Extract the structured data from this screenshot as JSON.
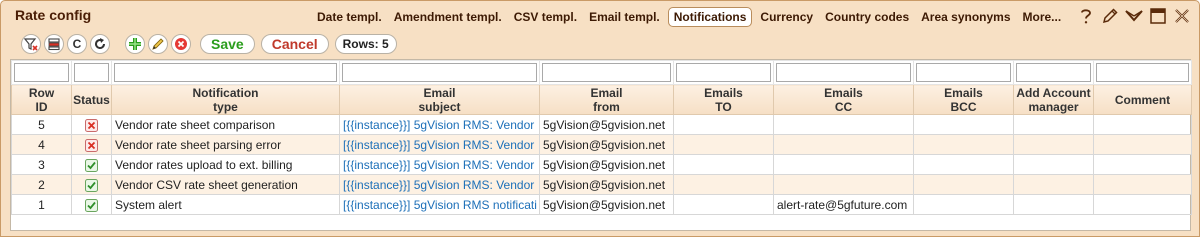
{
  "window": {
    "title": "Rate config"
  },
  "tabs": [
    {
      "label": "Date templ.",
      "active": false
    },
    {
      "label": "Amendment templ.",
      "active": false
    },
    {
      "label": "CSV templ.",
      "active": false
    },
    {
      "label": "Email templ.",
      "active": false
    },
    {
      "label": "Notifications",
      "active": true
    },
    {
      "label": "Currency",
      "active": false
    },
    {
      "label": "Country codes",
      "active": false
    },
    {
      "label": "Area synonyms",
      "active": false
    },
    {
      "label": "More...",
      "active": false
    }
  ],
  "window_icons": [
    "help-icon",
    "pencil-icon",
    "chevron-down-icon",
    "maximize-icon",
    "close-icon"
  ],
  "toolbar": {
    "buttons": [
      "clear-filter-icon",
      "columns-icon",
      "C",
      "reload-icon",
      "add-icon",
      "edit-icon",
      "delete-icon"
    ],
    "save_label": "Save",
    "cancel_label": "Cancel",
    "rows_label": "Rows: 5"
  },
  "grid": {
    "columns": [
      {
        "line1": "Row",
        "line2": "ID"
      },
      {
        "line1": "Status",
        "line2": ""
      },
      {
        "line1": "Notification",
        "line2": "type"
      },
      {
        "line1": "Email",
        "line2": "subject"
      },
      {
        "line1": "Email",
        "line2": "from"
      },
      {
        "line1": "Emails",
        "line2": "TO"
      },
      {
        "line1": "Emails",
        "line2": "CC"
      },
      {
        "line1": "Emails",
        "line2": "BCC"
      },
      {
        "line1": "Add Account",
        "line2": "manager"
      },
      {
        "line1": "Comment",
        "line2": ""
      }
    ],
    "rows": [
      {
        "id": "5",
        "status": "error",
        "type": "Vendor rate sheet comparison",
        "subject": "[{{instance}}] 5gVision RMS: Vendor",
        "from": "5gVision@5gvision.net",
        "to": "",
        "cc": "",
        "bcc": "",
        "manager": "",
        "comment": ""
      },
      {
        "id": "4",
        "status": "error",
        "type": "Vendor rate sheet parsing error",
        "subject": "[{{instance}}] 5gVision RMS: Vendor",
        "from": "5gVision@5gvision.net",
        "to": "",
        "cc": "",
        "bcc": "",
        "manager": "",
        "comment": ""
      },
      {
        "id": "3",
        "status": "ok",
        "type": "Vendor rates upload to ext. billing",
        "subject": "[{{instance}}] 5gVision RMS: Vendor",
        "from": "5gVision@5gvision.net",
        "to": "",
        "cc": "",
        "bcc": "",
        "manager": "",
        "comment": ""
      },
      {
        "id": "2",
        "status": "ok",
        "type": "Vendor CSV rate sheet generation",
        "subject": "[{{instance}}] 5gVision RMS: Vendor",
        "from": "5gVision@5gvision.net",
        "to": "",
        "cc": "",
        "bcc": "",
        "manager": "",
        "comment": ""
      },
      {
        "id": "1",
        "status": "ok",
        "type": "System alert",
        "subject": "[{{instance}}] 5gVision RMS notificati",
        "from": "5gVision@5gvision.net",
        "to": "",
        "cc": "alert-rate@5gfuture.com",
        "bcc": "",
        "manager": "",
        "comment": ""
      }
    ]
  },
  "colors": {
    "accent": "#f7e0c4",
    "save": "#2a9d1c",
    "cancel": "#c0392b",
    "link": "#1c6fb8",
    "ok": "#3aa63a",
    "error": "#d93025"
  }
}
